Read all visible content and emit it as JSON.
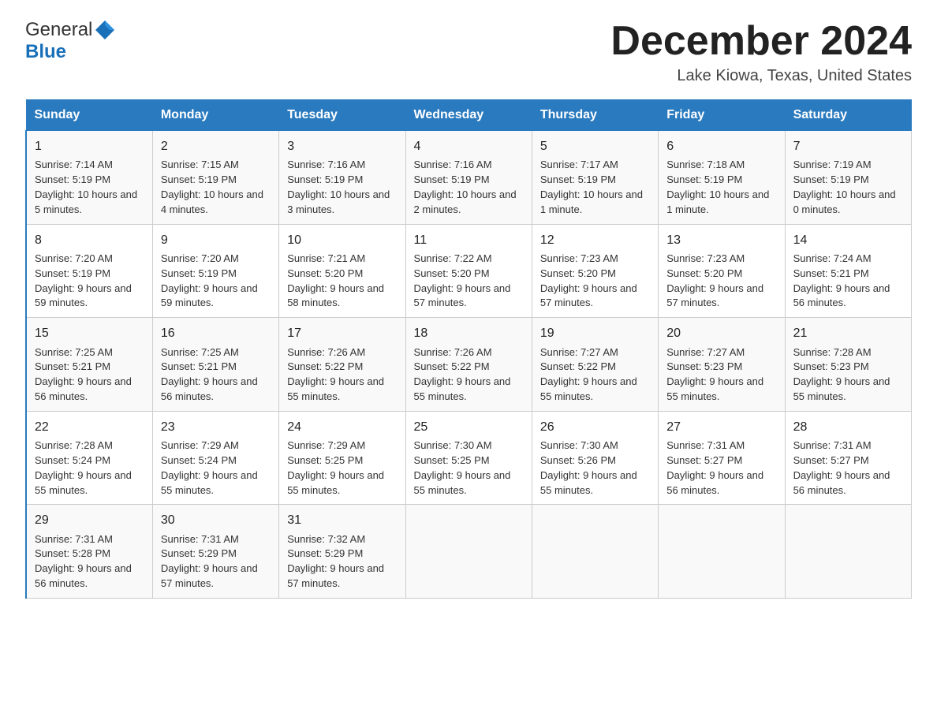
{
  "header": {
    "logo_general": "General",
    "logo_blue": "Blue",
    "month_title": "December 2024",
    "location": "Lake Kiowa, Texas, United States"
  },
  "calendar": {
    "days": [
      "Sunday",
      "Monday",
      "Tuesday",
      "Wednesday",
      "Thursday",
      "Friday",
      "Saturday"
    ],
    "weeks": [
      [
        {
          "day": "1",
          "sunrise": "7:14 AM",
          "sunset": "5:19 PM",
          "daylight": "10 hours and 5 minutes."
        },
        {
          "day": "2",
          "sunrise": "7:15 AM",
          "sunset": "5:19 PM",
          "daylight": "10 hours and 4 minutes."
        },
        {
          "day": "3",
          "sunrise": "7:16 AM",
          "sunset": "5:19 PM",
          "daylight": "10 hours and 3 minutes."
        },
        {
          "day": "4",
          "sunrise": "7:16 AM",
          "sunset": "5:19 PM",
          "daylight": "10 hours and 2 minutes."
        },
        {
          "day": "5",
          "sunrise": "7:17 AM",
          "sunset": "5:19 PM",
          "daylight": "10 hours and 1 minute."
        },
        {
          "day": "6",
          "sunrise": "7:18 AM",
          "sunset": "5:19 PM",
          "daylight": "10 hours and 1 minute."
        },
        {
          "day": "7",
          "sunrise": "7:19 AM",
          "sunset": "5:19 PM",
          "daylight": "10 hours and 0 minutes."
        }
      ],
      [
        {
          "day": "8",
          "sunrise": "7:20 AM",
          "sunset": "5:19 PM",
          "daylight": "9 hours and 59 minutes."
        },
        {
          "day": "9",
          "sunrise": "7:20 AM",
          "sunset": "5:19 PM",
          "daylight": "9 hours and 59 minutes."
        },
        {
          "day": "10",
          "sunrise": "7:21 AM",
          "sunset": "5:20 PM",
          "daylight": "9 hours and 58 minutes."
        },
        {
          "day": "11",
          "sunrise": "7:22 AM",
          "sunset": "5:20 PM",
          "daylight": "9 hours and 57 minutes."
        },
        {
          "day": "12",
          "sunrise": "7:23 AM",
          "sunset": "5:20 PM",
          "daylight": "9 hours and 57 minutes."
        },
        {
          "day": "13",
          "sunrise": "7:23 AM",
          "sunset": "5:20 PM",
          "daylight": "9 hours and 57 minutes."
        },
        {
          "day": "14",
          "sunrise": "7:24 AM",
          "sunset": "5:21 PM",
          "daylight": "9 hours and 56 minutes."
        }
      ],
      [
        {
          "day": "15",
          "sunrise": "7:25 AM",
          "sunset": "5:21 PM",
          "daylight": "9 hours and 56 minutes."
        },
        {
          "day": "16",
          "sunrise": "7:25 AM",
          "sunset": "5:21 PM",
          "daylight": "9 hours and 56 minutes."
        },
        {
          "day": "17",
          "sunrise": "7:26 AM",
          "sunset": "5:22 PM",
          "daylight": "9 hours and 55 minutes."
        },
        {
          "day": "18",
          "sunrise": "7:26 AM",
          "sunset": "5:22 PM",
          "daylight": "9 hours and 55 minutes."
        },
        {
          "day": "19",
          "sunrise": "7:27 AM",
          "sunset": "5:22 PM",
          "daylight": "9 hours and 55 minutes."
        },
        {
          "day": "20",
          "sunrise": "7:27 AM",
          "sunset": "5:23 PM",
          "daylight": "9 hours and 55 minutes."
        },
        {
          "day": "21",
          "sunrise": "7:28 AM",
          "sunset": "5:23 PM",
          "daylight": "9 hours and 55 minutes."
        }
      ],
      [
        {
          "day": "22",
          "sunrise": "7:28 AM",
          "sunset": "5:24 PM",
          "daylight": "9 hours and 55 minutes."
        },
        {
          "day": "23",
          "sunrise": "7:29 AM",
          "sunset": "5:24 PM",
          "daylight": "9 hours and 55 minutes."
        },
        {
          "day": "24",
          "sunrise": "7:29 AM",
          "sunset": "5:25 PM",
          "daylight": "9 hours and 55 minutes."
        },
        {
          "day": "25",
          "sunrise": "7:30 AM",
          "sunset": "5:25 PM",
          "daylight": "9 hours and 55 minutes."
        },
        {
          "day": "26",
          "sunrise": "7:30 AM",
          "sunset": "5:26 PM",
          "daylight": "9 hours and 55 minutes."
        },
        {
          "day": "27",
          "sunrise": "7:31 AM",
          "sunset": "5:27 PM",
          "daylight": "9 hours and 56 minutes."
        },
        {
          "day": "28",
          "sunrise": "7:31 AM",
          "sunset": "5:27 PM",
          "daylight": "9 hours and 56 minutes."
        }
      ],
      [
        {
          "day": "29",
          "sunrise": "7:31 AM",
          "sunset": "5:28 PM",
          "daylight": "9 hours and 56 minutes."
        },
        {
          "day": "30",
          "sunrise": "7:31 AM",
          "sunset": "5:29 PM",
          "daylight": "9 hours and 57 minutes."
        },
        {
          "day": "31",
          "sunrise": "7:32 AM",
          "sunset": "5:29 PM",
          "daylight": "9 hours and 57 minutes."
        },
        null,
        null,
        null,
        null
      ]
    ]
  }
}
